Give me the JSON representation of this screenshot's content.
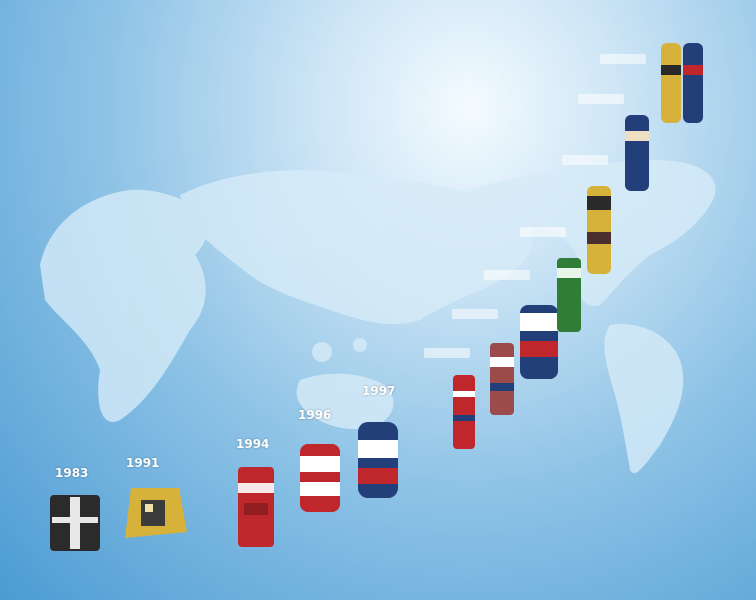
{
  "timeline": {
    "labels": [
      "1983",
      "1991",
      "1994",
      "1996",
      "1997"
    ],
    "colors": {
      "land": "#d7ecf8",
      "red": "#c0272d",
      "gold": "#d7b23b",
      "navy": "#233f7a",
      "green": "#2f7d36"
    },
    "items": [
      {
        "icon": "black-square-battery-icon"
      },
      {
        "icon": "gold-square-battery-icon"
      },
      {
        "icon": "red-can-battery-icon"
      },
      {
        "icon": "red-white-can-battery-icon"
      },
      {
        "icon": "blue-can-battery-icon"
      },
      {
        "icon": "small-red-battery-icon"
      },
      {
        "icon": "small-striped-battery-icon"
      },
      {
        "icon": "white-blue-battery-icon"
      },
      {
        "icon": "green-battery-icon"
      },
      {
        "icon": "gold-cylinder-battery-icon"
      },
      {
        "icon": "blue-cylinder-battery-icon"
      },
      {
        "icon": "battery-pair-icon"
      }
    ]
  }
}
